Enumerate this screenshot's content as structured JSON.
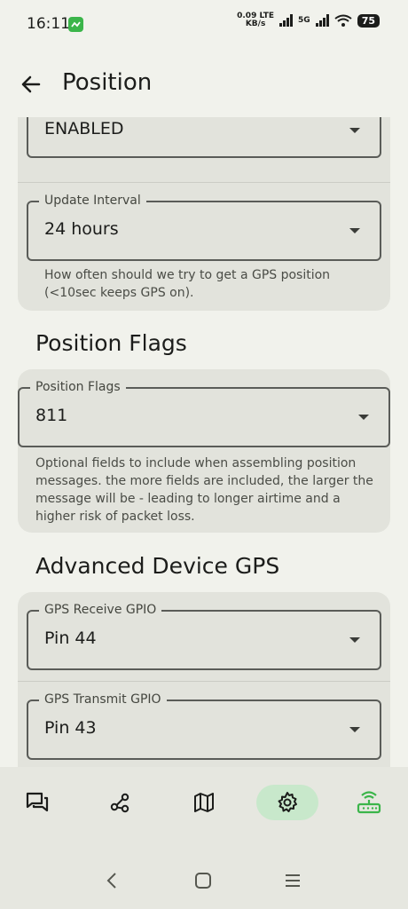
{
  "status": {
    "time": "16:11",
    "net_speed_value": "0.09",
    "net_speed_unit": "KB/s",
    "lte": "LTE",
    "fiveg": "5G",
    "battery": "75"
  },
  "header": {
    "title": "Position",
    "back_icon": "arrow-left-icon"
  },
  "position_card": {
    "first_value": "ENABLED",
    "update_interval": {
      "label": "Update Interval",
      "value": "24 hours",
      "helper": "How often should we try to get a GPS position (<10sec keeps GPS on)."
    }
  },
  "flags_section": {
    "title": "Position Flags",
    "field": {
      "label": "Position Flags",
      "value": "811",
      "helper": "Optional fields to include when assembling position messages. the more fields are included, the larger the message will be - leading to longer airtime and a higher risk of packet loss."
    }
  },
  "advanced_section": {
    "title": "Advanced Device GPS",
    "rx": {
      "label": "GPS Receive GPIO",
      "value": "Pin 44"
    },
    "tx": {
      "label": "GPS Transmit GPIO",
      "value": "Pin 43"
    }
  },
  "nav": {
    "items": [
      "messages-icon",
      "nodes-icon",
      "map-icon",
      "settings-icon",
      "connection-icon"
    ],
    "active": "settings-icon",
    "accent": "#3bb54a"
  },
  "system_nav": [
    "back-chevron-icon",
    "home-icon",
    "recents-icon"
  ]
}
